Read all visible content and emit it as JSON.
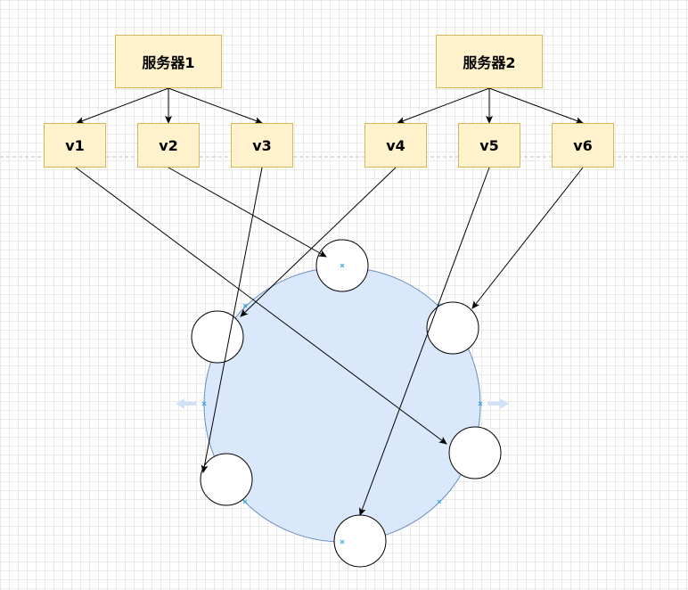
{
  "servers": [
    {
      "label": "服务器1",
      "children": [
        "v1",
        "v2",
        "v3"
      ]
    },
    {
      "label": "服务器2",
      "children": [
        "v4",
        "v5",
        "v6"
      ]
    }
  ],
  "vnodes": [
    "v1",
    "v2",
    "v3",
    "v4",
    "v5",
    "v6"
  ],
  "mapping": {
    "v1": "ring-node-right-lower",
    "v2": "ring-node-top",
    "v3": "ring-node-left-lower",
    "v4": "ring-node-left-upper",
    "v5": "ring-node-bottom",
    "v6": "ring-node-right-upper"
  },
  "colors": {
    "box_fill": "#fff2cc",
    "box_stroke": "#d6b656",
    "ring_fill": "#dae8fc",
    "ring_stroke": "#6c8ebf"
  }
}
